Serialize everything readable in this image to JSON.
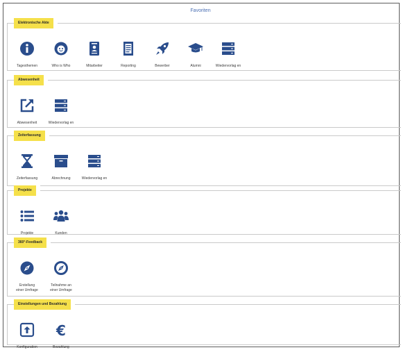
{
  "header": {
    "title": "Favoriten"
  },
  "colors": {
    "icon": "#2a4d8c",
    "label_bg": "#f5e04a"
  },
  "sections": [
    {
      "title": "Elektronische Akte",
      "items": [
        {
          "label": "Tagesthemen",
          "icon": "info-icon"
        },
        {
          "label": "Who is Who",
          "icon": "smiley-icon"
        },
        {
          "label": "Mitarbeiter",
          "icon": "id-badge-icon"
        },
        {
          "label": "Reporting",
          "icon": "document-icon"
        },
        {
          "label": "Bewerber",
          "icon": "rocket-icon"
        },
        {
          "label": "Alumni",
          "icon": "graduation-cap-icon"
        },
        {
          "label": "Wiedervorlag en",
          "icon": "server-stack-icon"
        }
      ]
    },
    {
      "title": "Abwesenheit",
      "items": [
        {
          "label": "Abwesenheit",
          "icon": "external-link-icon"
        },
        {
          "label": "Wiedervorlag en",
          "icon": "server-stack-icon"
        }
      ]
    },
    {
      "title": "Zeiterfassung",
      "items": [
        {
          "label": "Zeiterfassung",
          "icon": "hourglass-icon"
        },
        {
          "label": "Abrechnung",
          "icon": "archive-box-icon"
        },
        {
          "label": "Wiedervorlag en",
          "icon": "server-stack-icon"
        }
      ]
    },
    {
      "title": "Projekte",
      "items": [
        {
          "label": "Projekte",
          "icon": "list-icon"
        },
        {
          "label": "Kunden",
          "icon": "users-icon"
        }
      ]
    },
    {
      "title": "360°-Feedback",
      "items": [
        {
          "label": "Erstellung einer Umfrage",
          "icon": "compass-icon"
        },
        {
          "label": "Teilnahme an einer Umfrage",
          "icon": "compass-outline-icon"
        }
      ]
    },
    {
      "title": "Einstellungen und Bezahlung",
      "items": [
        {
          "label": "Konfiguration",
          "icon": "upload-box-icon"
        },
        {
          "label": "Bezahlung",
          "icon": "euro-icon"
        }
      ]
    }
  ]
}
